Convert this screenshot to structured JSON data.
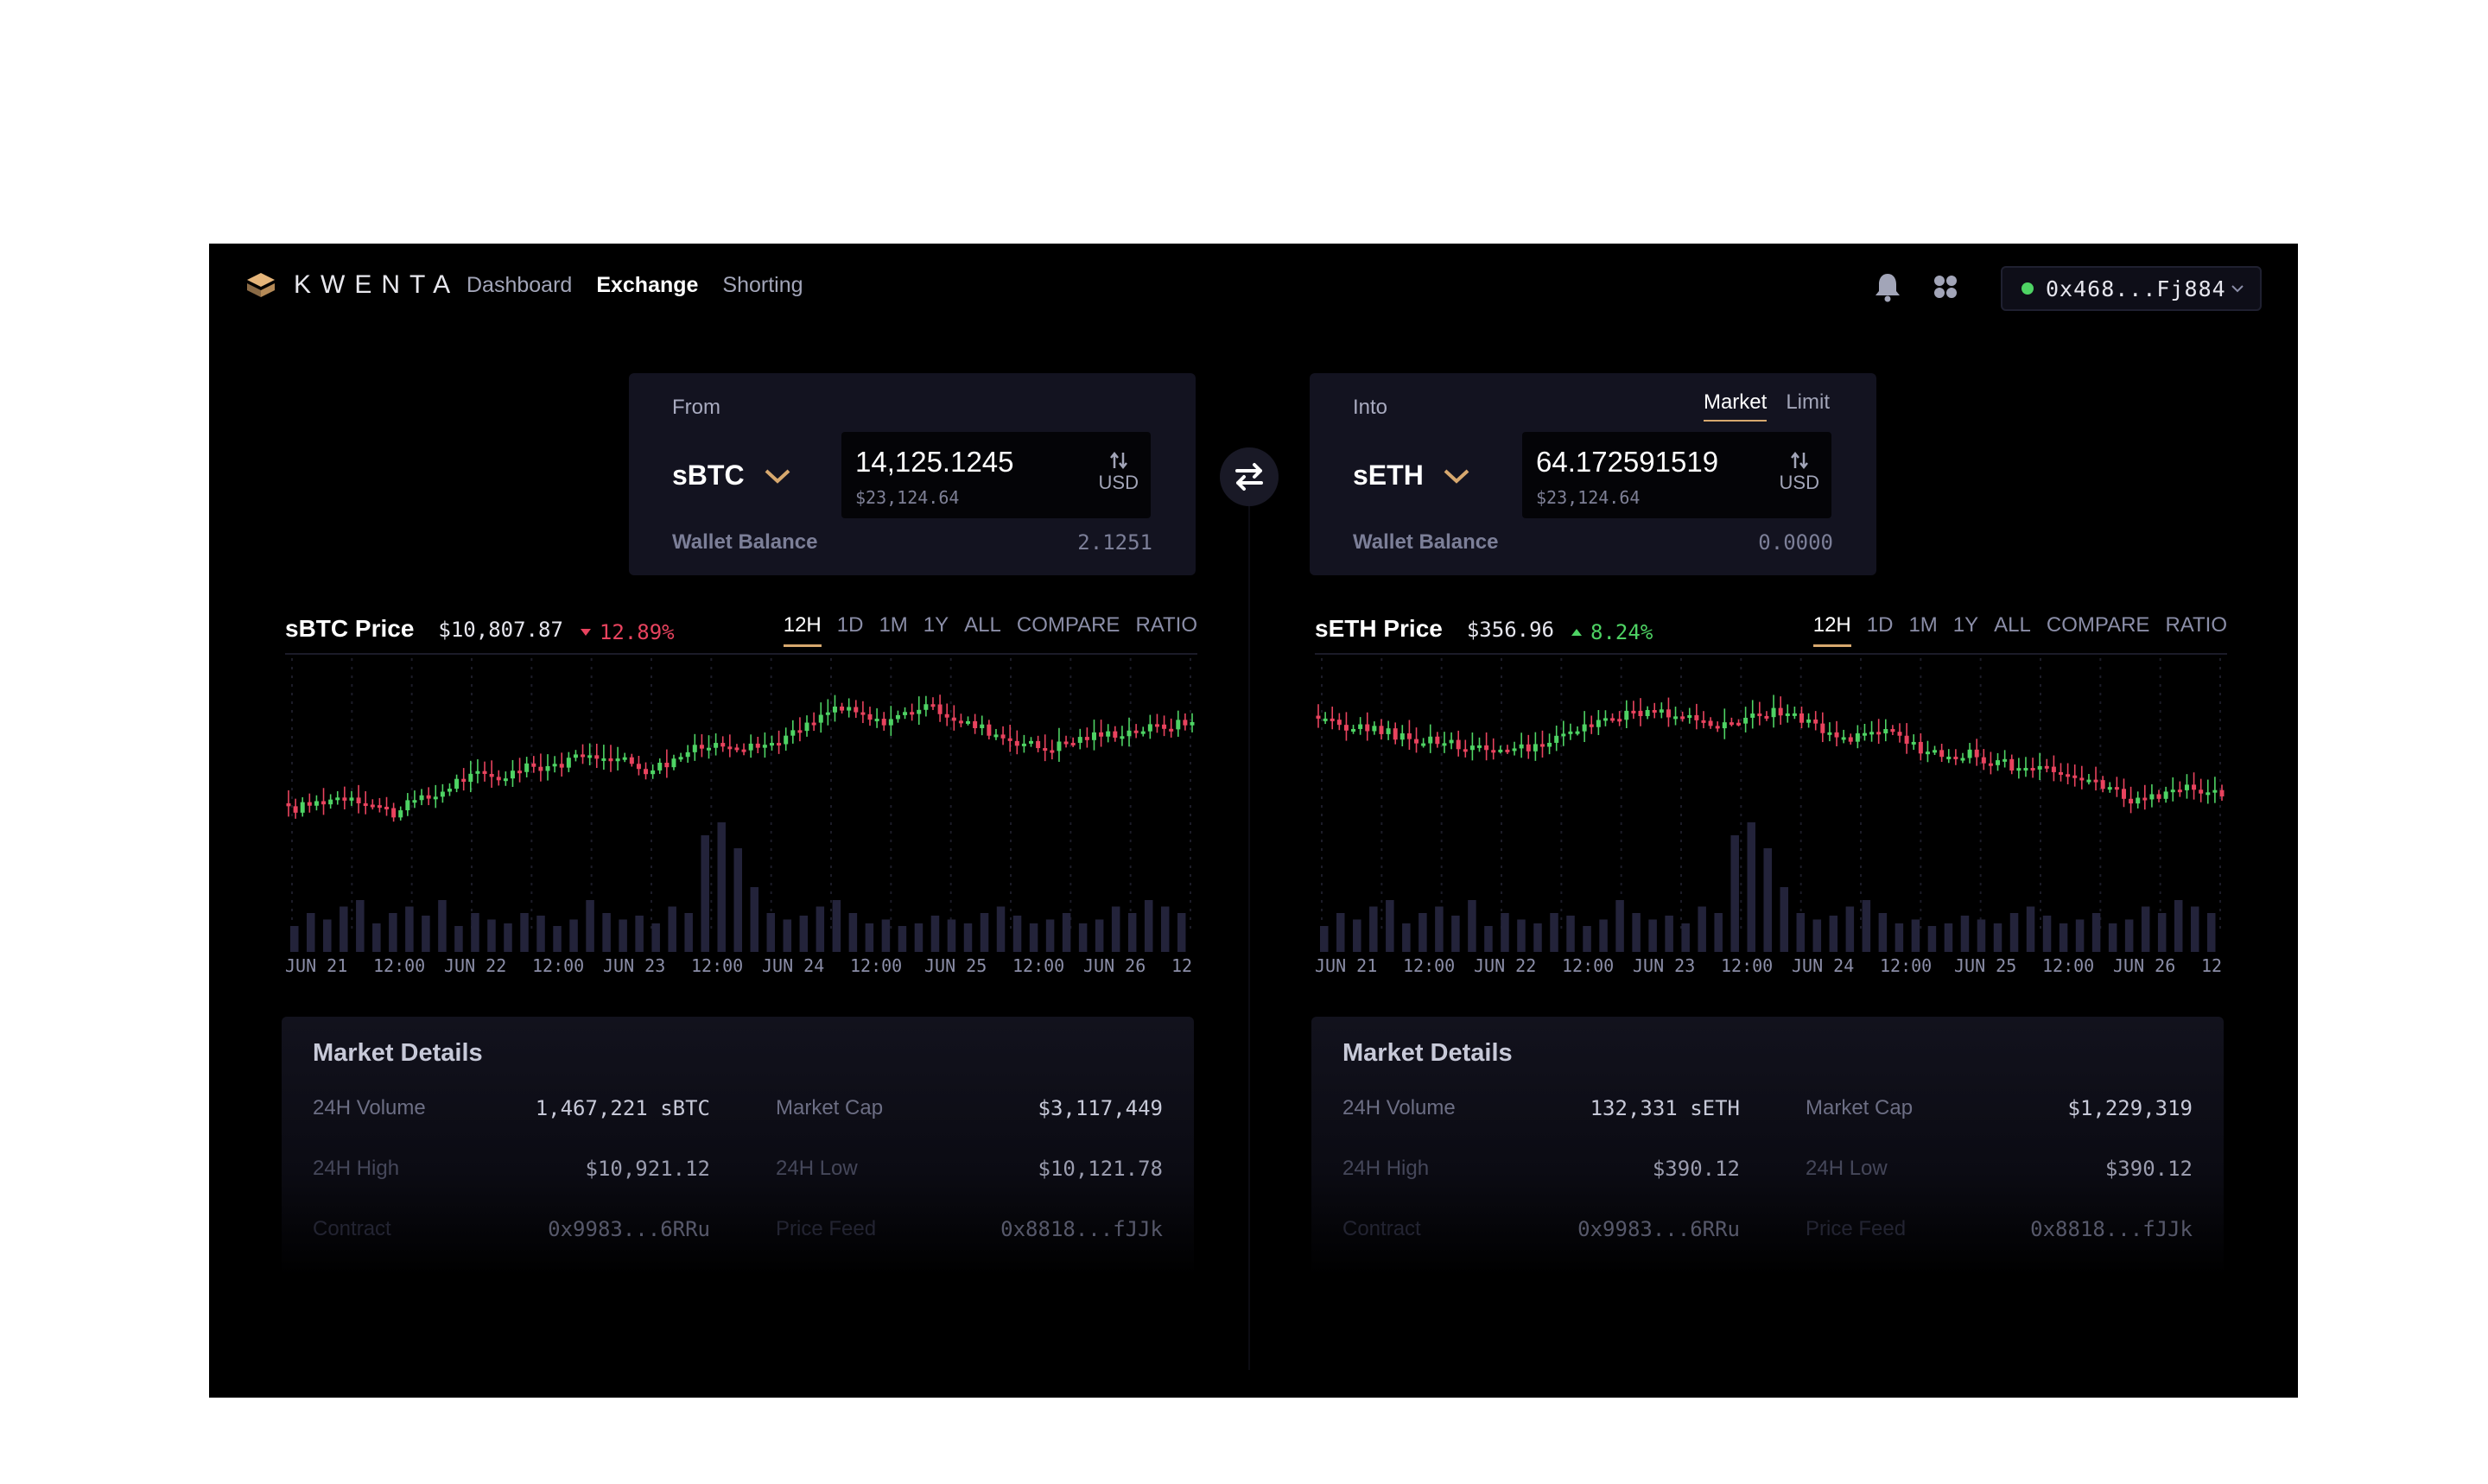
{
  "brand": {
    "name": "KWENTA"
  },
  "nav": [
    {
      "label": "Dashboard",
      "active": false
    },
    {
      "label": "Exchange",
      "active": true
    },
    {
      "label": "Shorting",
      "active": false
    }
  ],
  "wallet": {
    "address": "0x468...Fj884",
    "status_color": "#4ed364"
  },
  "icons": {
    "notifications": "bell-icon",
    "apps": "grid-icon",
    "swap": "swap-arrows-icon",
    "currency_toggle": "up-down-arrows-icon"
  },
  "colors": {
    "accent": "#d7a86e",
    "up": "#4ed364",
    "down": "#e8435e",
    "background": "#000000",
    "card": "#131320"
  },
  "exchange": {
    "from": {
      "label": "From",
      "currency": "sBTC",
      "amount": "14,125.1245",
      "amount_usd": "$23,124.64",
      "toggle_label": "USD",
      "balance_label": "Wallet Balance",
      "balance": "2.1251"
    },
    "into": {
      "label": "Into",
      "currency": "sETH",
      "amount": "64.172591519",
      "amount_usd": "$23,124.64",
      "toggle_label": "USD",
      "balance_label": "Wallet Balance",
      "balance": "0.0000",
      "order_types": [
        {
          "label": "Market",
          "active": true
        },
        {
          "label": "Limit",
          "active": false
        }
      ]
    }
  },
  "periods": [
    "12H",
    "1D",
    "1M",
    "1Y",
    "ALL",
    "COMPARE",
    "RATIO"
  ],
  "active_period": "12H",
  "charts": [
    {
      "title": "sBTC Price",
      "price": "$10,807.87",
      "change": "12.89%",
      "change_direction": "down"
    },
    {
      "title": "sETH Price",
      "price": "$356.96",
      "change": "8.24%",
      "change_direction": "up"
    }
  ],
  "chart_data": [
    {
      "type": "candlestick",
      "x_tick_labels": [
        "JUN 21",
        "12:00",
        "JUN 22",
        "12:00",
        "JUN 23",
        "12:00",
        "JUN 24",
        "12:00",
        "JUN 25",
        "12:00",
        "JUN 26",
        "12"
      ],
      "price_shape": [
        0.2,
        0.24,
        0.28,
        0.3,
        0.24,
        0.18,
        0.26,
        0.3,
        0.4,
        0.44,
        0.42,
        0.48,
        0.5,
        0.52,
        0.56,
        0.58,
        0.54,
        0.48,
        0.52,
        0.6,
        0.64,
        0.66,
        0.62,
        0.66,
        0.72,
        0.8,
        0.9,
        0.86,
        0.8,
        0.84,
        0.9,
        0.88,
        0.8,
        0.76,
        0.7,
        0.66,
        0.62,
        0.66,
        0.7,
        0.72,
        0.74,
        0.76,
        0.78,
        0.8
      ],
      "volume_shape": [
        0.2,
        0.3,
        0.25,
        0.35,
        0.4,
        0.22,
        0.3,
        0.35,
        0.28,
        0.4,
        0.2,
        0.3,
        0.25,
        0.22,
        0.3,
        0.28,
        0.2,
        0.25,
        0.4,
        0.3,
        0.25,
        0.28,
        0.22,
        0.35,
        0.3,
        0.9,
        1.0,
        0.8,
        0.5,
        0.3,
        0.25,
        0.28,
        0.35,
        0.4,
        0.3,
        0.22,
        0.25,
        0.2,
        0.22,
        0.28,
        0.25,
        0.22,
        0.3,
        0.35,
        0.28,
        0.22,
        0.25,
        0.3,
        0.22,
        0.25,
        0.35,
        0.3,
        0.4,
        0.35,
        0.3
      ]
    },
    {
      "type": "candlestick",
      "x_tick_labels": [
        "JUN 21",
        "12:00",
        "JUN 22",
        "12:00",
        "JUN 23",
        "12:00",
        "JUN 24",
        "12:00",
        "JUN 25",
        "12:00",
        "JUN 26",
        "12"
      ],
      "price_shape": [
        0.8,
        0.78,
        0.76,
        0.74,
        0.7,
        0.68,
        0.66,
        0.64,
        0.62,
        0.6,
        0.62,
        0.66,
        0.72,
        0.78,
        0.82,
        0.86,
        0.88,
        0.84,
        0.8,
        0.78,
        0.8,
        0.84,
        0.88,
        0.82,
        0.74,
        0.68,
        0.7,
        0.72,
        0.66,
        0.6,
        0.56,
        0.58,
        0.54,
        0.5,
        0.48,
        0.46,
        0.42,
        0.38,
        0.32,
        0.26,
        0.3,
        0.36,
        0.34,
        0.3
      ],
      "volume_shape": [
        0.2,
        0.3,
        0.25,
        0.35,
        0.4,
        0.22,
        0.3,
        0.35,
        0.28,
        0.4,
        0.2,
        0.3,
        0.25,
        0.22,
        0.3,
        0.28,
        0.2,
        0.25,
        0.4,
        0.3,
        0.25,
        0.28,
        0.22,
        0.35,
        0.3,
        0.9,
        1.0,
        0.8,
        0.5,
        0.3,
        0.25,
        0.28,
        0.35,
        0.4,
        0.3,
        0.22,
        0.25,
        0.2,
        0.22,
        0.28,
        0.25,
        0.22,
        0.3,
        0.35,
        0.28,
        0.22,
        0.25,
        0.3,
        0.22,
        0.25,
        0.35,
        0.3,
        0.4,
        0.35,
        0.3
      ]
    }
  ],
  "market_details": [
    {
      "title": "Market Details",
      "rows": [
        [
          {
            "k": "24H Volume",
            "v": "1,467,221 sBTC"
          },
          {
            "k": "Market Cap",
            "v": "$3,117,449"
          }
        ],
        [
          {
            "k": "24H High",
            "v": "$10,921.12"
          },
          {
            "k": "24H Low",
            "v": "$10,121.78"
          }
        ],
        [
          {
            "k": "Contract",
            "v": "0x9983...6RRu"
          },
          {
            "k": "Price Feed",
            "v": "0x8818...fJJk"
          }
        ]
      ]
    },
    {
      "title": "Market Details",
      "rows": [
        [
          {
            "k": "24H Volume",
            "v": "132,331 sETH"
          },
          {
            "k": "Market Cap",
            "v": "$1,229,319"
          }
        ],
        [
          {
            "k": "24H High",
            "v": "$390.12"
          },
          {
            "k": "24H Low",
            "v": "$390.12"
          }
        ],
        [
          {
            "k": "Contract",
            "v": "0x9983...6RRu"
          },
          {
            "k": "Price Feed",
            "v": "0x8818...fJJk"
          }
        ]
      ]
    }
  ]
}
